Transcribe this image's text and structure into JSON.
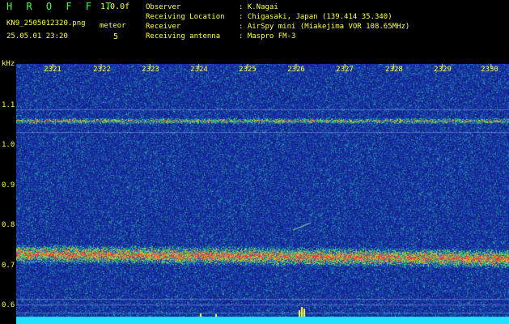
{
  "header": {
    "app_title": "H R O F F T",
    "version": "1.0.0f",
    "filename": "KN9_2505012320.png",
    "datetime": "25.05.01 23:20",
    "meteor_label": "meteor",
    "meteor_count": "5"
  },
  "observation": [
    {
      "label": "Observer",
      "value": ": K.Nagai"
    },
    {
      "label": "Receiving Location",
      "value": ": Chigasaki, Japan (139.414 35.340)"
    },
    {
      "label": "Receiver",
      "value": ": AirSpy mini (Miakejima VOR 108.65MHz)"
    },
    {
      "label": "Receiving antenna",
      "value": ": Maspro FM-3"
    }
  ],
  "axis": {
    "unit": "kHz",
    "y_ticks": [
      "1.1",
      "1.0",
      "0.9",
      "0.8",
      "0.7",
      "0.6"
    ],
    "x_ticks": [
      "2321",
      "2322",
      "2323",
      "2324",
      "2325",
      "2326",
      "2327",
      "2328",
      "2329",
      "2330"
    ]
  },
  "colors": {
    "background": "#000000",
    "noise_floor": "#1a2a9a",
    "text": "#ffff40",
    "title": "#40ff40",
    "signal_strong": "#ff3050",
    "signal_mid": "#30e070",
    "baseline": "#20e0ff"
  }
}
